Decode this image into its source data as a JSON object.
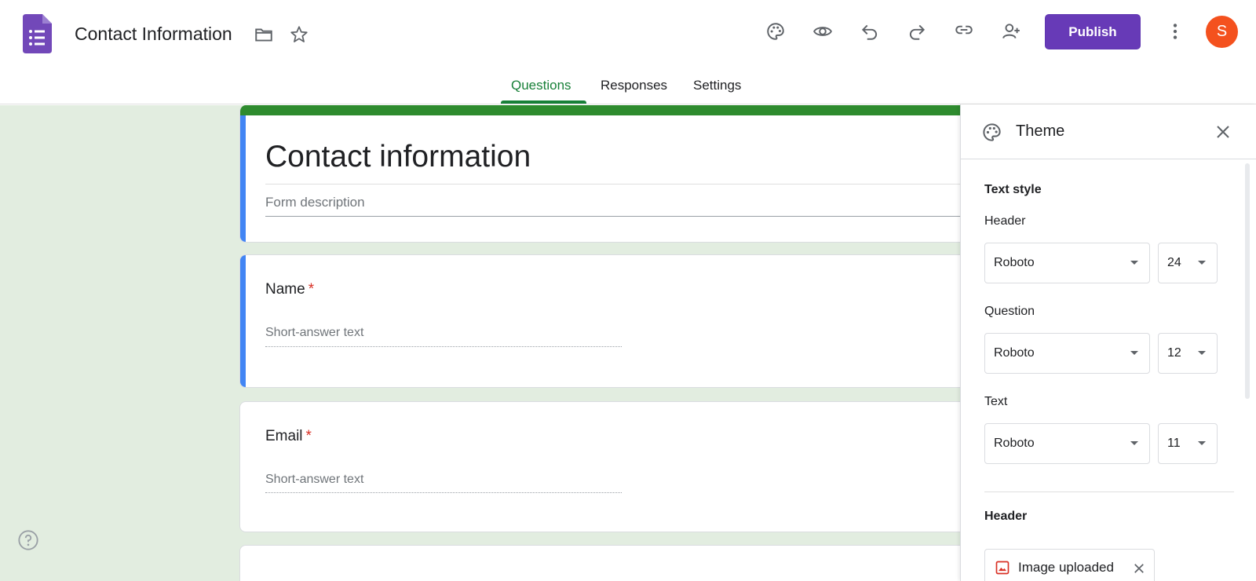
{
  "app": {
    "doc_title": "Contact Information",
    "icon": "google-forms-icon"
  },
  "toolbar": {
    "publish_label": "Publish",
    "avatar_initial": "S",
    "icons": [
      "palette-icon",
      "preview-eye-icon",
      "undo-icon",
      "redo-icon",
      "link-icon",
      "add-collaborator-icon",
      "more-vert-icon"
    ]
  },
  "tabs": [
    {
      "label": "Questions",
      "active": true
    },
    {
      "label": "Responses",
      "active": false
    },
    {
      "label": "Settings",
      "active": false
    }
  ],
  "form": {
    "title": "Contact information",
    "description_placeholder": "Form description",
    "questions": [
      {
        "label": "Name",
        "required_mark": "*",
        "placeholder": "Short-answer text"
      },
      {
        "label": "Email",
        "required_mark": "*",
        "placeholder": "Short-answer text"
      }
    ]
  },
  "theme_panel": {
    "title": "Theme",
    "text_style_heading": "Text style",
    "styles": [
      {
        "label": "Header",
        "font": "Roboto",
        "size": "24"
      },
      {
        "label": "Question",
        "font": "Roboto",
        "size": "12"
      },
      {
        "label": "Text",
        "font": "Roboto",
        "size": "11"
      }
    ],
    "header_heading": "Header",
    "image_chip_label": "Image uploaded"
  },
  "colors": {
    "accent_purple": "#673ab7",
    "tab_active_green": "#188038",
    "form_band_green": "#2e8b2e",
    "canvas_bg": "#e2ede0",
    "question_accent_blue": "#4285f4",
    "avatar_orange": "#f4511e",
    "required_red": "#d93025"
  }
}
